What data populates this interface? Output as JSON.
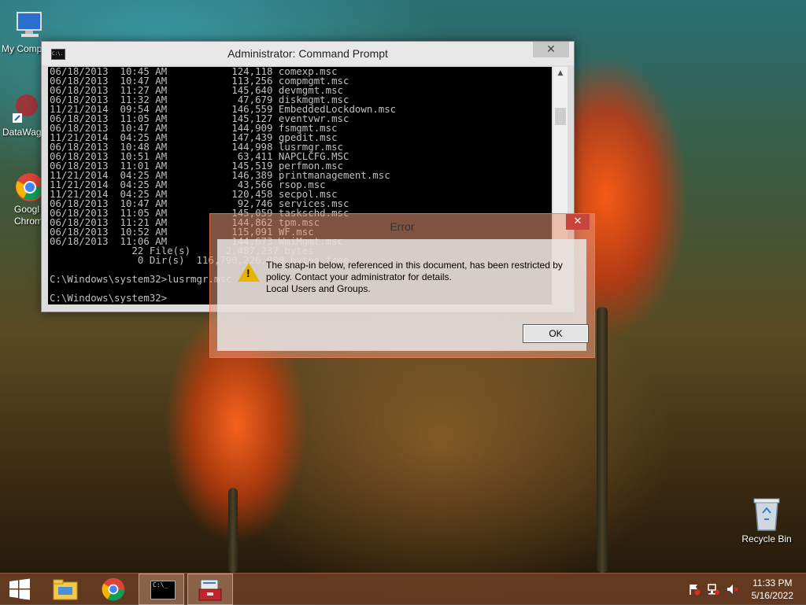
{
  "desktop": {
    "icons": [
      {
        "label": "My Comp"
      },
      {
        "label": "DataWag"
      },
      {
        "label": "Googl\nChrom"
      },
      {
        "label": "Recycle Bin"
      }
    ]
  },
  "cmd_window": {
    "title": "Administrator: Command Prompt",
    "icon_text": "C:\\.",
    "close_label": "✕",
    "lines": [
      "06/18/2013  10:45 AM           124,118 comexp.msc",
      "06/18/2013  10:47 AM           113,256 compmgmt.msc",
      "06/18/2013  11:27 AM           145,640 devmgmt.msc",
      "06/18/2013  11:32 AM            47,679 diskmgmt.msc",
      "11/21/2014  09:54 AM           146,559 EmbeddedLockdown.msc",
      "06/18/2013  11:05 AM           145,127 eventvwr.msc",
      "06/18/2013  10:47 AM           144,909 fsmgmt.msc",
      "11/21/2014  04:25 AM           147,439 gpedit.msc",
      "06/18/2013  10:48 AM           144,998 lusrmgr.msc",
      "06/18/2013  10:51 AM            63,411 NAPCLCFG.MSC",
      "06/18/2013  11:01 AM           145,519 perfmon.msc",
      "11/21/2014  04:25 AM           146,389 printmanagement.msc",
      "11/21/2014  04:25 AM            43,566 rsop.msc",
      "11/21/2014  04:25 AM           120,458 secpol.msc",
      "06/18/2013  10:47 AM            92,746 services.msc",
      "06/18/2013  11:05 AM           145,059 taskschd.msc",
      "06/18/2013  11:21 AM           144,862 tpm.msc",
      "06/18/2013  10:52 AM           115,091 WF.msc",
      "06/18/2013  11:06 AM           144,673 WmiMgmt.msc",
      "              22 File(s)      2,487,237 bytes",
      "               0 Dir(s)  116,790,226,000 bytes free",
      "",
      "C:\\Windows\\system32>lusrmgr.msc",
      "",
      "C:\\Windows\\system32>"
    ]
  },
  "error_dialog": {
    "title": "Error",
    "close_label": "✕",
    "icon": "warning-icon",
    "message_line1": "The snap-in below, referenced in this document, has been restricted by policy. Contact your administrator for details.",
    "message_line2": "Local Users and Groups.",
    "ok_label": "OK"
  },
  "taskbar": {
    "items": [
      "start",
      "file-explorer",
      "chrome",
      "command-prompt",
      "toolbox"
    ],
    "clock_time": "11:33 PM",
    "clock_date": "5/16/2022"
  }
}
